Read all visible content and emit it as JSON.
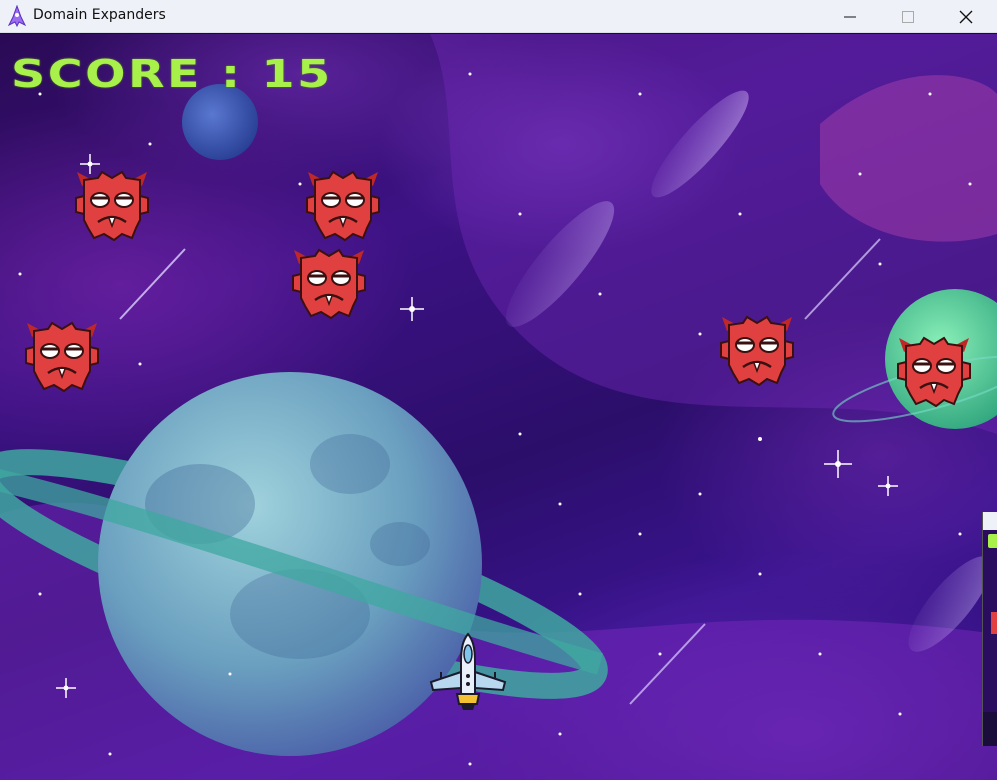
{
  "window": {
    "title": "Domain Expanders",
    "icon": "rocket-icon",
    "controls": [
      "minimize-icon",
      "maximize-icon",
      "close-icon"
    ]
  },
  "hud": {
    "score_label": "SCORE : 15"
  },
  "colors": {
    "score": "#a8f04a",
    "enemy": "#e04040",
    "background": "#3a1490",
    "planet": "#7fb8c8",
    "ring": "#3fa8a0"
  },
  "sprites": {
    "enemy_icon": "red-monster-icon",
    "player_icon": "spaceship-icon"
  }
}
